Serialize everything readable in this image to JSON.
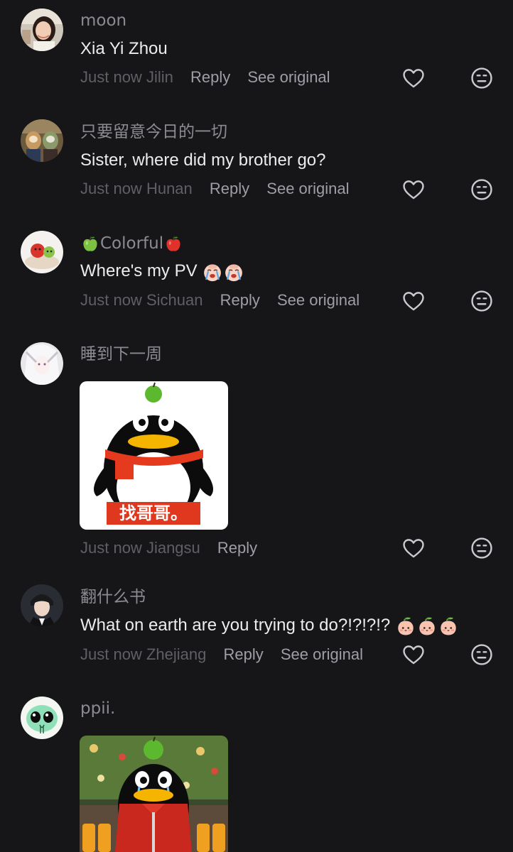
{
  "comments": [
    {
      "username": "moon",
      "text": "Xia Yi Zhou",
      "time": "Just now",
      "location": "Jilin",
      "reply_label": "Reply",
      "see_original_label": "See original"
    },
    {
      "username": "只要留意今日的一切",
      "text": "Sister, where did my brother go?",
      "time": "Just now",
      "location": "Hunan",
      "reply_label": "Reply",
      "see_original_label": "See original"
    },
    {
      "username": "Colorful",
      "text": "Where's my PV",
      "time": "Just now",
      "location": "Sichuan",
      "reply_label": "Reply",
      "see_original_label": "See original"
    },
    {
      "username": "睡到下一周",
      "sticker_text": "找哥哥。",
      "time": "Just now",
      "location": "Jiangsu",
      "reply_label": "Reply"
    },
    {
      "username": "翻什么书",
      "text": "What on earth are you trying to do?!?!?!?",
      "time": "Just now",
      "location": "Zhejiang",
      "reply_label": "Reply",
      "see_original_label": "See original"
    },
    {
      "username": "ppii."
    }
  ],
  "icons": {
    "like": "heart-outline-icon",
    "dislike": "neutral-face-icon"
  },
  "colors": {
    "background": "#161619",
    "primary_text": "#ececee",
    "username": "#8b8b92",
    "meta_time": "#5f5f66",
    "meta_link": "#9e9ea6"
  }
}
